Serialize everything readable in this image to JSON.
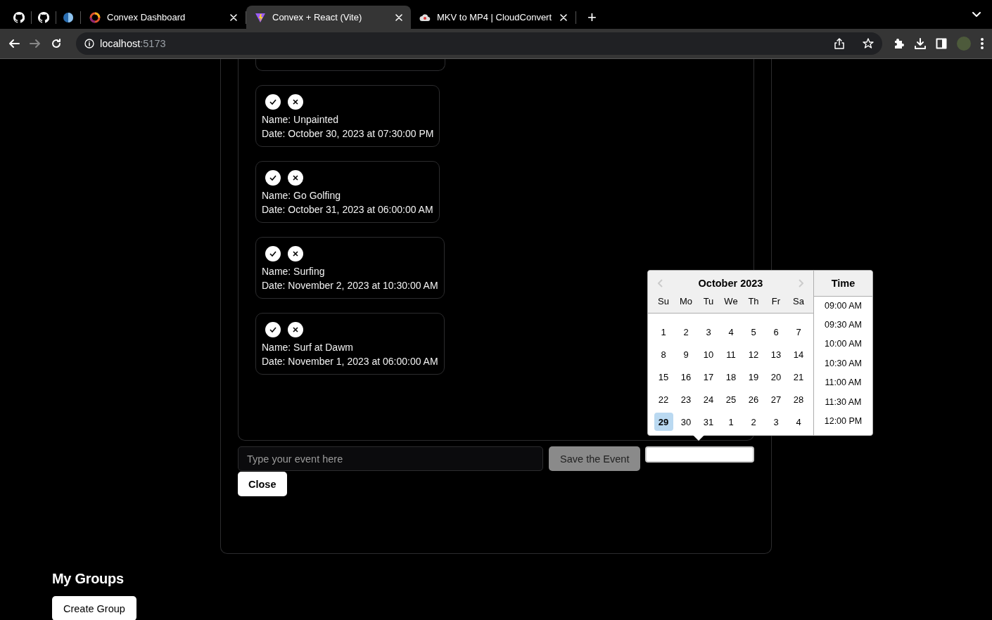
{
  "browser": {
    "pinned_tabs": [
      {
        "kind": "github"
      },
      {
        "kind": "github"
      },
      {
        "kind": "globe"
      }
    ],
    "tabs": [
      {
        "title": "Convex Dashboard",
        "kind": "ring",
        "selected": false
      },
      {
        "title": "Convex + React (Vite)",
        "kind": "triangle",
        "selected": true
      },
      {
        "title": "MKV to MP4 | CloudConvert",
        "kind": "cloud",
        "selected": false
      }
    ],
    "new_tab": "+",
    "url": {
      "host": "localhost",
      "port": ":5173"
    }
  },
  "events": [
    {
      "name": "Name: Unpainted",
      "date": "Date: October 30, 2023 at 07:30:00 PM"
    },
    {
      "name": "Name: Go Golfing",
      "date": "Date: October 31, 2023 at 06:00:00 AM"
    },
    {
      "name": "Name: Surfing",
      "date": "Date: November 2, 2023 at 10:30:00 AM"
    },
    {
      "name": "Name: Surf at Dawm",
      "date": "Date: November 1, 2023 at 06:00:00 AM"
    }
  ],
  "event_input": {
    "placeholder": "Type your event here"
  },
  "save_button": {
    "label": "Save the Event",
    "disabled": true
  },
  "close_button": "Close",
  "date_picker": {
    "month": "October 2023",
    "weekdays": [
      "Su",
      "Mo",
      "Tu",
      "We",
      "Th",
      "Fr",
      "Sa"
    ],
    "days": [
      {
        "label": "1",
        "selected": false
      },
      {
        "label": "2",
        "selected": false
      },
      {
        "label": "3",
        "selected": false
      },
      {
        "label": "4",
        "selected": false
      },
      {
        "label": "5",
        "selected": false
      },
      {
        "label": "6",
        "selected": false
      },
      {
        "label": "7",
        "selected": false
      },
      {
        "label": "8",
        "selected": false
      },
      {
        "label": "9",
        "selected": false
      },
      {
        "label": "10",
        "selected": false
      },
      {
        "label": "11",
        "selected": false
      },
      {
        "label": "12",
        "selected": false
      },
      {
        "label": "13",
        "selected": false
      },
      {
        "label": "14",
        "selected": false
      },
      {
        "label": "15",
        "selected": false
      },
      {
        "label": "16",
        "selected": false
      },
      {
        "label": "17",
        "selected": false
      },
      {
        "label": "18",
        "selected": false
      },
      {
        "label": "19",
        "selected": false
      },
      {
        "label": "20",
        "selected": false
      },
      {
        "label": "21",
        "selected": false
      },
      {
        "label": "22",
        "selected": false
      },
      {
        "label": "23",
        "selected": false
      },
      {
        "label": "24",
        "selected": false
      },
      {
        "label": "25",
        "selected": false
      },
      {
        "label": "26",
        "selected": false
      },
      {
        "label": "27",
        "selected": false
      },
      {
        "label": "28",
        "selected": false
      },
      {
        "label": "29",
        "selected": true
      },
      {
        "label": "30",
        "selected": false
      },
      {
        "label": "31",
        "selected": false
      },
      {
        "label": "1",
        "selected": false
      },
      {
        "label": "2",
        "selected": false
      },
      {
        "label": "3",
        "selected": false
      },
      {
        "label": "4",
        "selected": false
      }
    ],
    "time_header": "Time",
    "times": [
      "09:00 AM",
      "09:30 AM",
      "10:00 AM",
      "10:30 AM",
      "11:00 AM",
      "11:30 AM",
      "12:00 PM"
    ]
  },
  "groups": {
    "heading": "My Groups",
    "create_button": "Create Group"
  }
}
